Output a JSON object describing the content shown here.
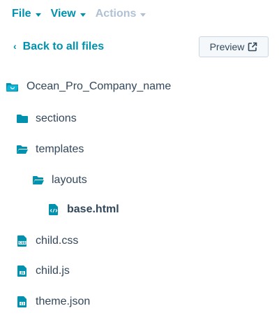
{
  "menubar": {
    "file": "File",
    "view": "View",
    "actions": "Actions"
  },
  "nav": {
    "back_label": "Back to all files",
    "preview_label": "Preview"
  },
  "tree": {
    "root": "Ocean_Pro_Company_name",
    "sections": "sections",
    "templates": "templates",
    "layouts": "layouts",
    "base_html": "base.html",
    "child_css": "child.css",
    "child_js": "child.js",
    "theme_json": "theme.json"
  },
  "colors": {
    "accent": "#0091ae",
    "text": "#33475b",
    "icon": "#0091ae",
    "disabled": "#b0c1d4"
  },
  "icons": {
    "root": "theme-folder-icon",
    "sections": "folder-icon",
    "templates": "folder-open-icon",
    "layouts": "folder-open-icon",
    "base_html": "html-file-icon",
    "child_css": "css-file-icon",
    "child_js": "js-file-icon",
    "theme_json": "json-file-icon"
  }
}
